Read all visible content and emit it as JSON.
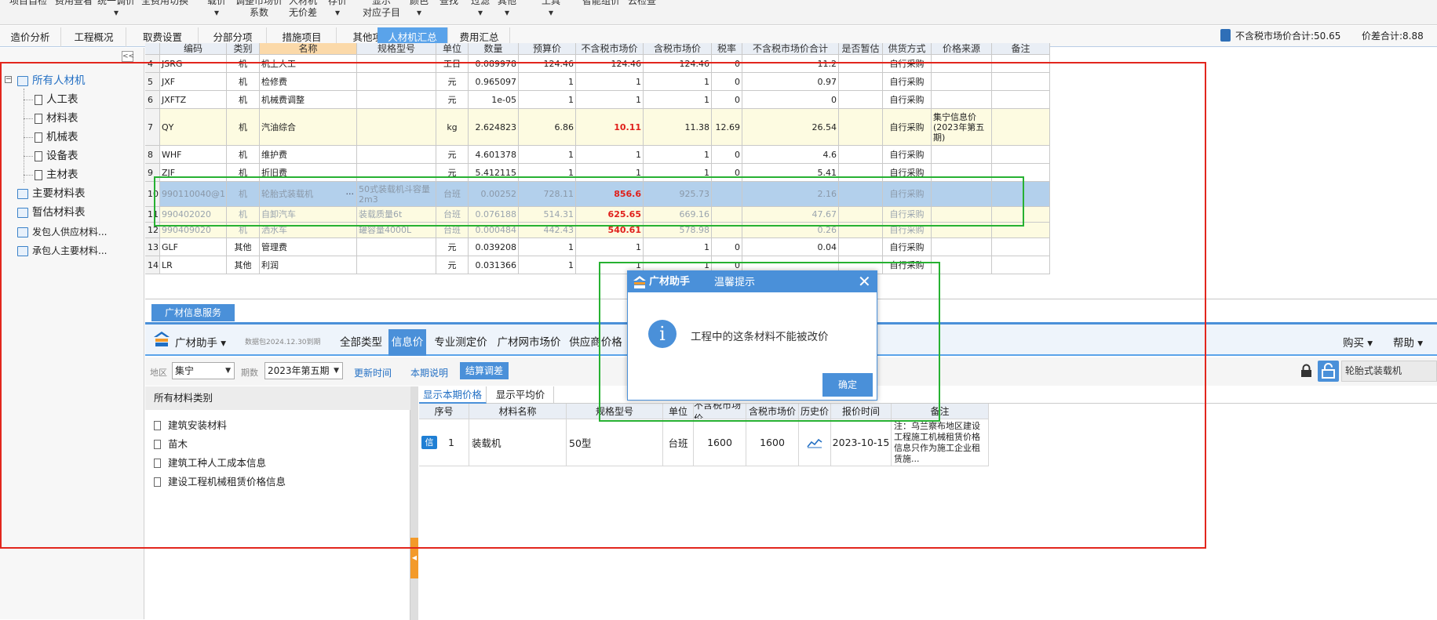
{
  "toolbar": {
    "items": [
      {
        "line1": "项目自检",
        "line2": ""
      },
      {
        "line1": "费用查看",
        "line2": ""
      },
      {
        "line1": "统一调价",
        "line2": "▾"
      },
      {
        "line1": "全费用切换",
        "line2": ""
      },
      {
        "line1": "载价",
        "line2": "▾"
      },
      {
        "line1": "调整市场价",
        "line2": "系数"
      },
      {
        "line1": "人材机",
        "line2": "无价差"
      },
      {
        "line1": "存价",
        "line2": "▾"
      },
      {
        "line1": "显示",
        "line2": "对应子目"
      },
      {
        "line1": "颜色",
        "line2": "▾"
      },
      {
        "line1": "查找",
        "line2": ""
      },
      {
        "line1": "过滤",
        "line2": "▾"
      },
      {
        "line1": "其他",
        "line2": "▾"
      },
      {
        "line1": "工具",
        "line2": "▾"
      },
      {
        "line1": "智能组价",
        "line2": ""
      },
      {
        "line1": "云检查",
        "line2": ""
      }
    ]
  },
  "tabs": [
    "造价分析",
    "工程概况",
    "取费设置",
    "分部分项",
    "措施项目",
    "其他项目",
    "人材机汇总",
    "费用汇总"
  ],
  "active_tab": "人材机汇总",
  "summary": {
    "market_total": "不含税市场价合计:50.65",
    "diff_total": "价差合计:8.88"
  },
  "tree": {
    "collapse_label": "<<",
    "root": "所有人材机",
    "children": [
      "人工表",
      "材料表",
      "机械表",
      "设备表",
      "主材表"
    ],
    "others": [
      "主要材料表",
      "暂估材料表",
      "发包人供应材料...",
      "承包人主要材料..."
    ]
  },
  "table": {
    "headers": [
      "编码",
      "类别",
      "名称",
      "规格型号",
      "单位",
      "数量",
      "预算价",
      "不含税市场价",
      "含税市场价",
      "税率",
      "不含税市场价合计",
      "是否暂估",
      "供货方式",
      "价格来源",
      "备注"
    ],
    "rows": [
      {
        "no": "4",
        "code": "JSRG",
        "cat": "机",
        "name": "机上人工",
        "spec": "",
        "unit": "工日",
        "qty": "0.089978",
        "budget": "124.46",
        "mkt": "124.46",
        "mkt_tax": "124.46",
        "rate": "0",
        "total": "11.2",
        "est": "",
        "supply": "自行采购",
        "source": "",
        "note": ""
      },
      {
        "no": "5",
        "code": "JXF",
        "cat": "机",
        "name": "检修费",
        "spec": "",
        "unit": "元",
        "qty": "0.965097",
        "budget": "1",
        "mkt": "1",
        "mkt_tax": "1",
        "rate": "0",
        "total": "0.97",
        "est": "",
        "supply": "自行采购",
        "source": "",
        "note": ""
      },
      {
        "no": "6",
        "code": "JXFTZ",
        "cat": "机",
        "name": "机械费调整",
        "spec": "",
        "unit": "元",
        "qty": "1e-05",
        "budget": "1",
        "mkt": "1",
        "mkt_tax": "1",
        "rate": "0",
        "total": "0",
        "est": "",
        "supply": "自行采购",
        "source": "",
        "note": ""
      },
      {
        "no": "7",
        "code": "QY",
        "cat": "机",
        "name": "汽油综合",
        "spec": "",
        "unit": "kg",
        "qty": "2.624823",
        "budget": "6.86",
        "mkt": "10.11",
        "mkt_tax": "11.38",
        "rate": "12.69",
        "total": "26.54",
        "est": "",
        "supply": "自行采购",
        "source": "集宁信息价(2023年第五期)",
        "note": ""
      },
      {
        "no": "8",
        "code": "WHF",
        "cat": "机",
        "name": "维护费",
        "spec": "",
        "unit": "元",
        "qty": "4.601378",
        "budget": "1",
        "mkt": "1",
        "mkt_tax": "1",
        "rate": "0",
        "total": "4.6",
        "est": "",
        "supply": "自行采购",
        "source": "",
        "note": ""
      },
      {
        "no": "9",
        "code": "ZJF",
        "cat": "机",
        "name": "折旧费",
        "spec": "",
        "unit": "元",
        "qty": "5.412115",
        "budget": "1",
        "mkt": "1",
        "mkt_tax": "1",
        "rate": "0",
        "total": "5.41",
        "est": "",
        "supply": "自行采购",
        "source": "",
        "note": ""
      },
      {
        "no": "10",
        "code": "990110040@1",
        "cat": "机",
        "name": "轮胎式装载机",
        "spec": "50式装载机斗容量2m3",
        "unit": "台班",
        "qty": "0.00252",
        "budget": "728.11",
        "mkt": "856.6",
        "mkt_tax": "925.73",
        "rate": "",
        "total": "2.16",
        "est": "",
        "supply": "自行采购",
        "source": "",
        "note": ""
      },
      {
        "no": "11",
        "code": "990402020",
        "cat": "机",
        "name": "自卸汽车",
        "spec": "装载质量6t",
        "unit": "台班",
        "qty": "0.076188",
        "budget": "514.31",
        "mkt": "625.65",
        "mkt_tax": "669.16",
        "rate": "",
        "total": "47.67",
        "est": "",
        "supply": "自行采购",
        "source": "",
        "note": ""
      },
      {
        "no": "12",
        "code": "990409020",
        "cat": "机",
        "name": "洒水车",
        "spec": "罐容量4000L",
        "unit": "台班",
        "qty": "0.000484",
        "budget": "442.43",
        "mkt": "540.61",
        "mkt_tax": "578.98",
        "rate": "",
        "total": "0.26",
        "est": "",
        "supply": "自行采购",
        "source": "",
        "note": ""
      },
      {
        "no": "13",
        "code": "GLF",
        "cat": "其他",
        "name": "管理费",
        "spec": "",
        "unit": "元",
        "qty": "0.039208",
        "budget": "1",
        "mkt": "1",
        "mkt_tax": "1",
        "rate": "0",
        "total": "0.04",
        "est": "",
        "supply": "自行采购",
        "source": "",
        "note": ""
      },
      {
        "no": "14",
        "code": "LR",
        "cat": "其他",
        "name": "利润",
        "spec": "",
        "unit": "元",
        "qty": "0.031366",
        "budget": "1",
        "mkt": "1",
        "mkt_tax": "1",
        "rate": "0",
        "total": "",
        "est": "",
        "supply": "自行采购",
        "source": "",
        "note": ""
      }
    ]
  },
  "service": {
    "tab_label": "广材信息服务",
    "brand": "广材助手",
    "data_expiry": "数据包2024.12.30到期",
    "nav": [
      "全部类型",
      "信息价",
      "专业测定价",
      "广材网市场价",
      "供应商价格"
    ],
    "active_nav": "信息价",
    "buy": "购买",
    "help": "帮助",
    "region_label": "地区",
    "region_value": "集宁",
    "period_label": "期数",
    "period_value": "2023年第五期",
    "update_time": "更新时间",
    "period_note": "本期说明",
    "settle_adjust": "结算调差",
    "search_value": "轮胎式装载机",
    "category_header": "所有材料类别",
    "categories": [
      "建筑安装材料",
      "苗木",
      "建筑工种人工成本信息",
      "建设工程机械租赁价格信息"
    ],
    "result_tabs": [
      "显示本期价格",
      "显示平均价"
    ],
    "result_headers": [
      "序号",
      "材料名称",
      "规格型号",
      "单位",
      "不含税市场价",
      "含税市场价",
      "历史价",
      "报价时间",
      "备注"
    ],
    "results": [
      {
        "badge": "信",
        "no": "1",
        "name": "装载机",
        "spec": "50型",
        "unit": "台班",
        "mkt": "1600",
        "mkt_tax": "1600",
        "date": "2023-10-15",
        "note": "注：乌兰察布地区建设工程施工机械租赁价格信息只作为施工企业租赁施..."
      }
    ]
  },
  "dialog": {
    "brand": "广材助手",
    "title": "温馨提示",
    "close": "✕",
    "info_icon": "i",
    "message": "工程中的这条材料不能被改价",
    "ok": "确定"
  },
  "colors": {
    "accent": "#4a90d9",
    "highlight_red": "#e2261d",
    "highlight_green": "#27b132",
    "price_red": "#e0201b"
  }
}
